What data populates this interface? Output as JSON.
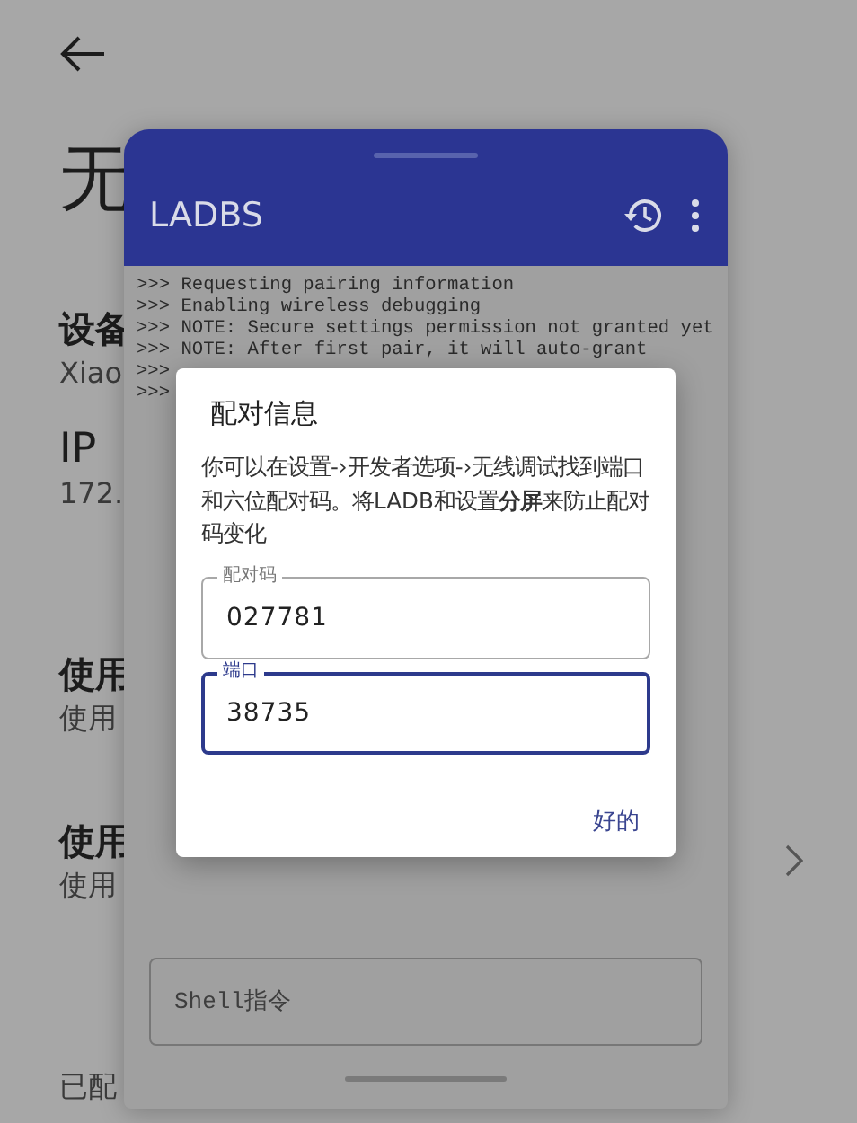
{
  "settings": {
    "title": "无",
    "sections": [
      {
        "title": "设备",
        "subtitle": "Xiao",
        "chevron": false
      },
      {
        "title": "IP",
        "subtitle": "172.",
        "chevron": false
      },
      {
        "title": "使用",
        "subtitle": "使用",
        "chevron": false
      },
      {
        "title": "使用",
        "subtitle": "使用",
        "chevron": true
      }
    ],
    "footer": "已配"
  },
  "ladb": {
    "title": "LADBS",
    "log": [
      ">>> Requesting pairing information",
      ">>> Enabling wireless debugging",
      ">>> NOTE: Secure settings permission not granted yet",
      ">>> NOTE: After first pair, it will auto-grant",
      ">>>",
      ">>>"
    ],
    "shell": {
      "placeholder": "Shell指令"
    }
  },
  "dialog": {
    "title": "配对信息",
    "message": "你可以在设置-›开发者选项-›无线调试找到端口和六位配对码。将LADB和设置**分屏**来防止配对码变化",
    "fields": [
      {
        "label": "配对码",
        "value": "027781",
        "focused": false
      },
      {
        "label": "端口",
        "value": "38735",
        "focused": true
      }
    ],
    "button": "好的"
  }
}
